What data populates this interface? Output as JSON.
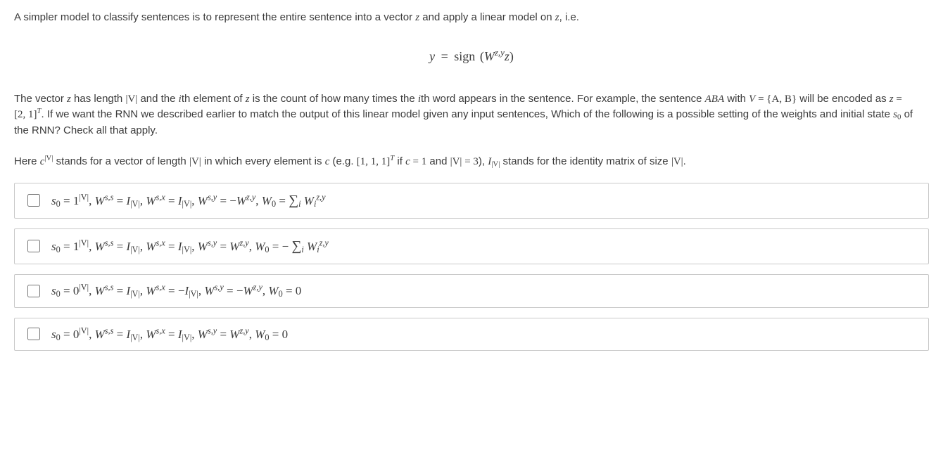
{
  "intro": {
    "p1_a": "A simpler model to classify sentences is to represent the entire sentence into a vector ",
    "p1_b": " and apply a linear model on ",
    "p1_c": ", i.e.",
    "z": "z"
  },
  "equation": {
    "y": "y",
    "eq": "=",
    "sign": "sign",
    "lpar": "(",
    "W": "W",
    "sup": "z,y",
    "z": "z",
    "rpar": ")"
  },
  "para2": {
    "t1": "The vector ",
    "z": "z",
    "t2": " has length ",
    "absV": "|V|",
    "t3": " and the ",
    "i": "i",
    "t4": "th element of ",
    "z2": "z",
    "t5": " is the count of how many times the ",
    "i2": "i",
    "t6": "th word appears in the sentence. For example, the sentence ",
    "ABA": "ABA",
    "t7": " with ",
    "V": "V",
    "t8": " = ",
    "set": "{A, B}",
    "t9": " will be encoded as ",
    "z3": "z",
    "t10": " = ",
    "vec": "[2, 1]",
    "T": "T",
    "t11": ". If we want the RNN we described earlier to match the output of this linear model given any input sentences, Which of the following is a possible setting of the weights and initial state ",
    "s0": "s",
    "zero": "0",
    "t12": " of the RNN? Check all that apply."
  },
  "para3": {
    "t1": "Here ",
    "c": "c",
    "absV": "|V|",
    "t2": " stands for a vector of length ",
    "absV2": "|V|",
    "t3": " in which every element is ",
    "c2": "c",
    "t4": " (e.g. ",
    "vec": "[1, 1, 1]",
    "T": "T",
    "t5": " if ",
    "c3": "c",
    "t6": " = ",
    "one": "1",
    "t7": " and ",
    "absV3": "|V|",
    "t8": " = ",
    "three": "3",
    "t9": "), ",
    "I": "I",
    "absV4": "|V|",
    "t10": " stands for the identity matrix of size ",
    "absV5": "|V|",
    "t11": "."
  },
  "options": [
    {
      "s0c": "1",
      "s0exp": "|V|",
      "Wss_sign": "",
      "Wss": "I",
      "Wss_sub": "|V|",
      "Wsx_sign": "",
      "Wsx": "I",
      "Wsx_sub": "|V|",
      "Wsy_sign": "−",
      "Wsy": "W",
      "Wsy_sup": "z,y",
      "W0_sign": "",
      "W0_expr": "∑_i W_i^{z,y}",
      "render": "s₀ = 1^{|V|}, W^{s,s} = I_{|V|}, W^{s,x} = I_{|V|}, W^{s,y} = −W^{z,y}, W₀ = ∑_i W_i^{z,y}"
    },
    {
      "s0c": "1",
      "s0exp": "|V|",
      "Wss_sign": "",
      "Wss": "I",
      "Wss_sub": "|V|",
      "Wsx_sign": "",
      "Wsx": "I",
      "Wsx_sub": "|V|",
      "Wsy_sign": "",
      "Wsy": "W",
      "Wsy_sup": "z,y",
      "W0_sign": "−",
      "W0_expr": "∑_i W_i^{z,y}",
      "render": "s₀ = 1^{|V|}, W^{s,s} = I_{|V|}, W^{s,x} = I_{|V|}, W^{s,y} = W^{z,y}, W₀ = −∑_i W_i^{z,y}"
    },
    {
      "s0c": "0",
      "s0exp": "|V|",
      "Wss_sign": "",
      "Wss": "I",
      "Wss_sub": "|V|",
      "Wsx_sign": "−",
      "Wsx": "I",
      "Wsx_sub": "|V|",
      "Wsy_sign": "−",
      "Wsy": "W",
      "Wsy_sup": "z,y",
      "W0_sign": "",
      "W0_expr": "0",
      "render": "s₀ = 0^{|V|}, W^{s,s} = I_{|V|}, W^{s,x} = −I_{|V|}, W^{s,y} = −W^{z,y}, W₀ = 0"
    },
    {
      "s0c": "0",
      "s0exp": "|V|",
      "Wss_sign": "",
      "Wss": "I",
      "Wss_sub": "|V|",
      "Wsx_sign": "",
      "Wsx": "I",
      "Wsx_sub": "|V|",
      "Wsy_sign": "",
      "Wsy": "W",
      "Wsy_sup": "z,y",
      "W0_sign": "",
      "W0_expr": "0",
      "render": "s₀ = 0^{|V|}, W^{s,s} = I_{|V|}, W^{s,x} = I_{|V|}, W^{s,y} = W^{z,y}, W₀ = 0"
    }
  ]
}
